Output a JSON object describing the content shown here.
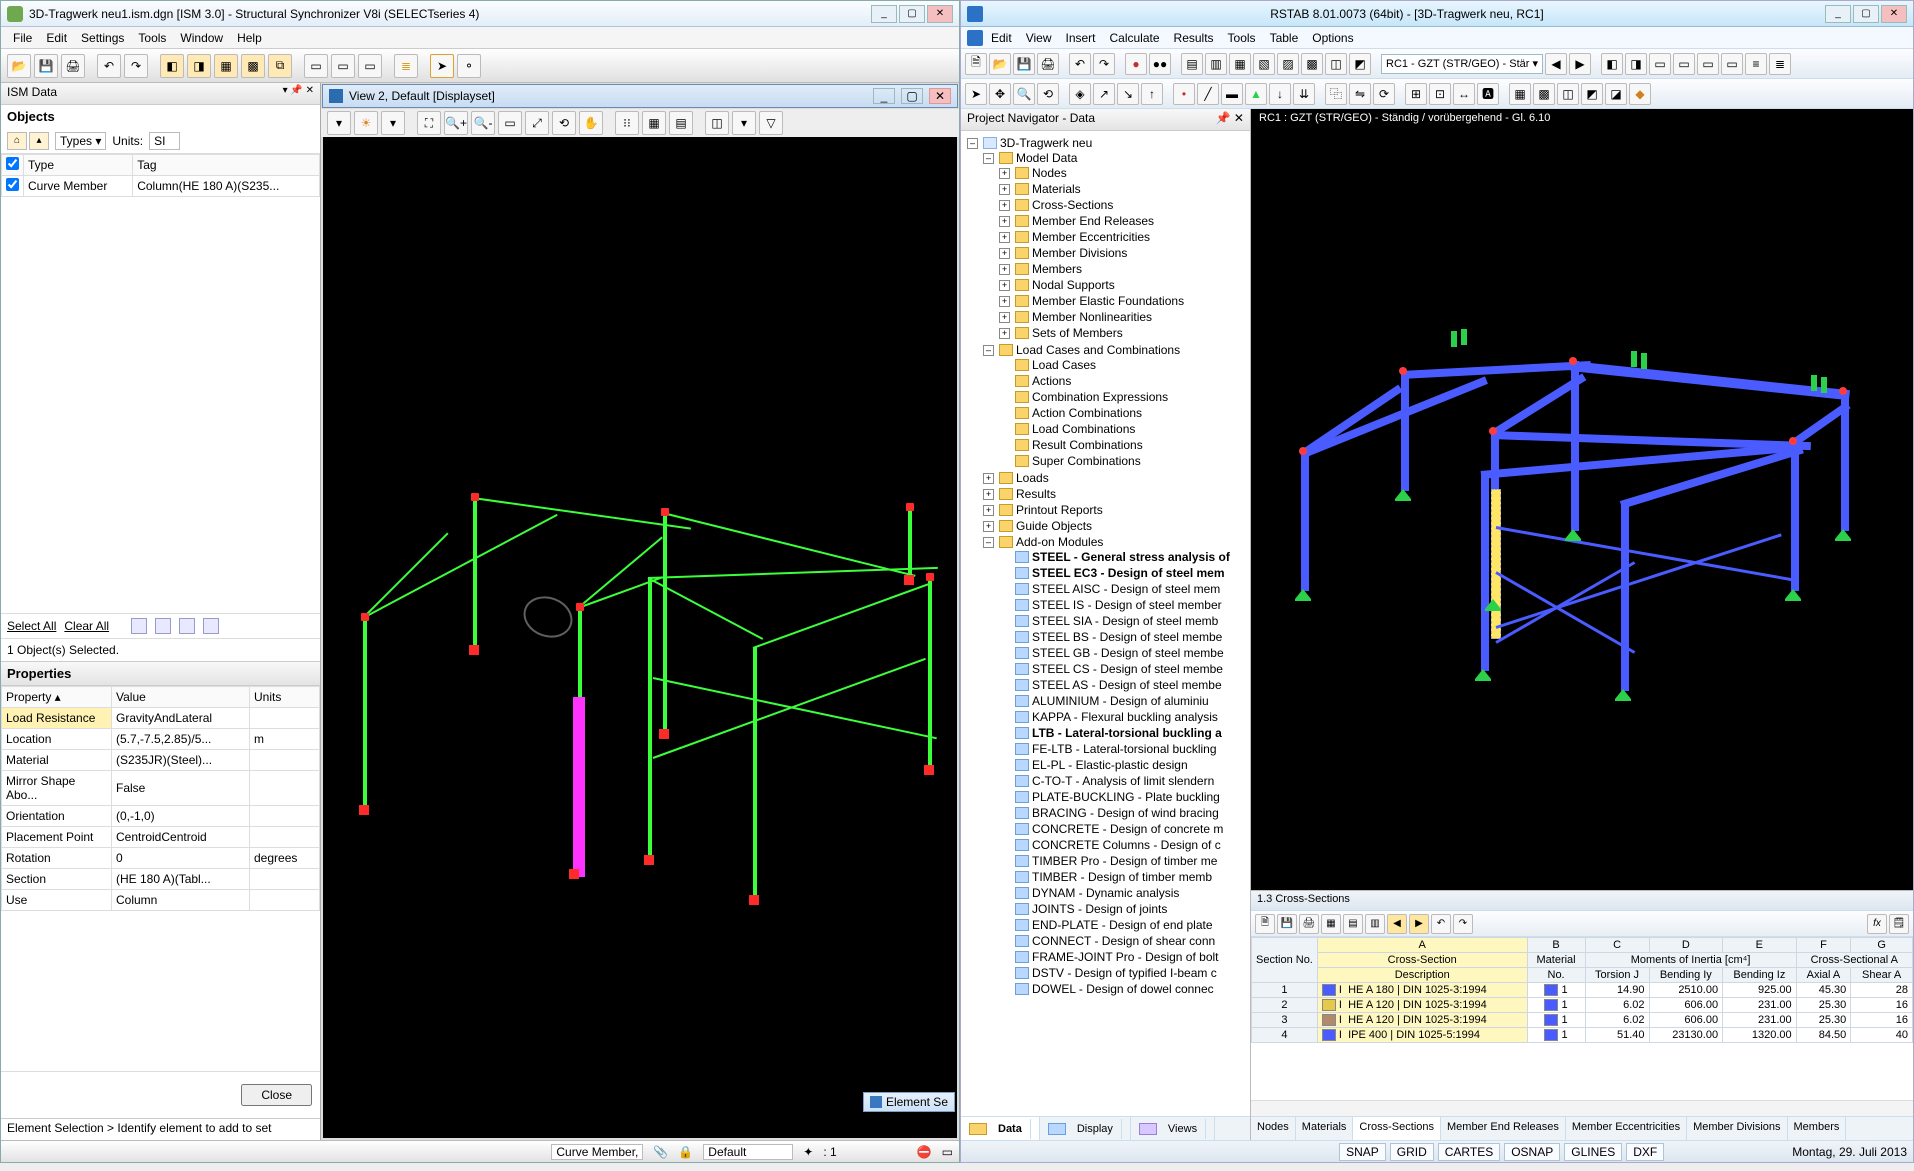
{
  "left": {
    "title": "3D-Tragwerk neu1.ism.dgn [ISM 3.0] - Structural Synchronizer V8i (SELECTseries 4)",
    "menu": [
      "File",
      "Edit",
      "Settings",
      "Tools",
      "Window",
      "Help"
    ],
    "ism_panel": {
      "header": "ISM Data",
      "objects_label": "Objects",
      "types_label": "Types ▾",
      "units_label": "Units:",
      "units_value": "SI",
      "grid_headers": [
        "",
        "Type",
        "Tag"
      ],
      "grid_row": {
        "type": "Curve Member",
        "tag": "Column(HE 180 A)(S235..."
      },
      "select_all": "Select All",
      "clear_all": "Clear All",
      "status": "1 Object(s) Selected.",
      "props_header": "Properties",
      "props_cols": [
        "Property ▴",
        "Value",
        "Units"
      ],
      "props": [
        {
          "k": "Load Resistance",
          "v": "GravityAndLateral",
          "u": ""
        },
        {
          "k": "Location",
          "v": "(5.7,-7.5,2.85)/5...",
          "u": "m"
        },
        {
          "k": "Material",
          "v": "(S235JR)(Steel)...",
          "u": ""
        },
        {
          "k": "Mirror Shape Abo...",
          "v": "False",
          "u": ""
        },
        {
          "k": "Orientation",
          "v": "(0,-1,0)",
          "u": ""
        },
        {
          "k": "Placement Point",
          "v": "CentroidCentroid",
          "u": ""
        },
        {
          "k": "Rotation",
          "v": "0",
          "u": "degrees"
        },
        {
          "k": "Section",
          "v": "(HE 180 A)(Tabl...",
          "u": ""
        },
        {
          "k": "Use",
          "v": "Column",
          "u": ""
        }
      ],
      "close_btn": "Close",
      "elem_status": "Element Selection > Identify element to add to set"
    },
    "view": {
      "title": "View 2, Default [Displayset]",
      "win_min": "_",
      "win_max": "▢",
      "win_close": "✕"
    },
    "statusbar": {
      "field1": "Curve Member,",
      "layer": "Default",
      "coord_ico": "✦",
      "coord": ": 1",
      "float_tab": "Element Se"
    }
  },
  "right": {
    "title": "RSTAB 8.01.0073 (64bit) - [3D-Tragwerk neu, RC1]",
    "menu": [
      "Edit",
      "View",
      "Insert",
      "Calculate",
      "Results",
      "Tools",
      "Table",
      "Options"
    ],
    "combo_loadcase": "RC1 - GZT (STR/GEO) - Stär ▾",
    "navigator": {
      "header": "Project Navigator - Data",
      "root": "3D-Tragwerk neu",
      "model_data": "Model Data",
      "model_items": [
        "Nodes",
        "Materials",
        "Cross-Sections",
        "Member End Releases",
        "Member Eccentricities",
        "Member Divisions",
        "Members",
        "Nodal Supports",
        "Member Elastic Foundations",
        "Member Nonlinearities",
        "Sets of Members"
      ],
      "loadcases": "Load Cases and Combinations",
      "loadcase_items": [
        "Load Cases",
        "Actions",
        "Combination Expressions",
        "Action Combinations",
        "Load Combinations",
        "Result Combinations",
        "Super Combinations"
      ],
      "loads": "Loads",
      "results": "Results",
      "printout": "Printout Reports",
      "guide": "Guide Objects",
      "addon": "Add-on Modules",
      "addons": [
        {
          "t": "STEEL - General stress analysis of",
          "b": true
        },
        {
          "t": "STEEL EC3 - Design of steel mem",
          "b": true
        },
        {
          "t": "STEEL AISC - Design of steel mem",
          "b": false
        },
        {
          "t": "STEEL IS - Design of steel member",
          "b": false
        },
        {
          "t": "STEEL SIA - Design of steel memb",
          "b": false
        },
        {
          "t": "STEEL BS - Design of steel membe",
          "b": false
        },
        {
          "t": "STEEL GB - Design of steel membe",
          "b": false
        },
        {
          "t": "STEEL CS - Design of steel membe",
          "b": false
        },
        {
          "t": "STEEL AS - Design of steel membe",
          "b": false
        },
        {
          "t": "ALUMINIUM - Design of aluminiu",
          "b": false
        },
        {
          "t": "KAPPA - Flexural buckling analysis",
          "b": false
        },
        {
          "t": "LTB - Lateral-torsional buckling a",
          "b": true
        },
        {
          "t": "FE-LTB - Lateral-torsional buckling",
          "b": false
        },
        {
          "t": "EL-PL - Elastic-plastic design",
          "b": false
        },
        {
          "t": "C-TO-T - Analysis of limit slendern",
          "b": false
        },
        {
          "t": "PLATE-BUCKLING - Plate buckling",
          "b": false
        },
        {
          "t": "BRACING - Design of wind bracing",
          "b": false
        },
        {
          "t": "CONCRETE - Design of concrete m",
          "b": false
        },
        {
          "t": "CONCRETE Columns - Design of c",
          "b": false
        },
        {
          "t": "TIMBER Pro - Design of timber me",
          "b": false
        },
        {
          "t": "TIMBER - Design of timber memb",
          "b": false
        },
        {
          "t": "DYNAM - Dynamic analysis",
          "b": false
        },
        {
          "t": "JOINTS - Design of joints",
          "b": false
        },
        {
          "t": "END-PLATE - Design of end plate",
          "b": false
        },
        {
          "t": "CONNECT - Design of shear conn",
          "b": false
        },
        {
          "t": "FRAME-JOINT Pro - Design of bolt",
          "b": false
        },
        {
          "t": "DSTV - Design of typified I-beam c",
          "b": false
        },
        {
          "t": "DOWEL - Design of dowel connec",
          "b": false
        }
      ],
      "tabs": [
        "Data",
        "Display",
        "Views"
      ]
    },
    "viewport_title": "RC1 : GZT (STR/GEO) - Ständig / vorübergehend - Gl. 6.10",
    "spreadsheet": {
      "title": "1.3 Cross-Sections",
      "col_letters": [
        "",
        "A",
        "B",
        "C",
        "D",
        "E",
        "F",
        "G"
      ],
      "group1": "Cross-Section",
      "group2": "Material",
      "group3": "Moments of Inertia [cm⁴]",
      "group4": "Cross-Sectional A",
      "sub": [
        "Section No.",
        "Description",
        "No.",
        "Torsion J",
        "Bending Iy",
        "Bending Iz",
        "Axial A",
        "Shear A"
      ],
      "rows": [
        {
          "no": "1",
          "sw": "#4a5cff",
          "desc": "HE A 180 | DIN 1025-3:1994",
          "mat": "1",
          "j": "14.90",
          "iy": "2510.00",
          "iz": "925.00",
          "a": "45.30",
          "sa": "28"
        },
        {
          "no": "2",
          "sw": "#e6c84a",
          "desc": "HE A 120 | DIN 1025-3:1994",
          "mat": "1",
          "j": "6.02",
          "iy": "606.00",
          "iz": "231.00",
          "a": "25.30",
          "sa": "16"
        },
        {
          "no": "3",
          "sw": "#b08a6a",
          "desc": "HE A 120 | DIN 1025-3:1994",
          "mat": "1",
          "j": "6.02",
          "iy": "606.00",
          "iz": "231.00",
          "a": "25.30",
          "sa": "16"
        },
        {
          "no": "4",
          "sw": "#4a5cff",
          "desc": "IPE 400 | DIN 1025-5:1994",
          "mat": "1",
          "j": "51.40",
          "iy": "23130.00",
          "iz": "1320.00",
          "a": "84.50",
          "sa": "40"
        }
      ],
      "tabs": [
        "Nodes",
        "Materials",
        "Cross-Sections",
        "Member End Releases",
        "Member Eccentricities",
        "Member Divisions",
        "Members"
      ]
    },
    "statusbar": {
      "items": [
        "SNAP",
        "GRID",
        "CARTES",
        "OSNAP",
        "GLINES",
        "DXF"
      ],
      "date": "Montag, 29. Juli 2013"
    }
  }
}
